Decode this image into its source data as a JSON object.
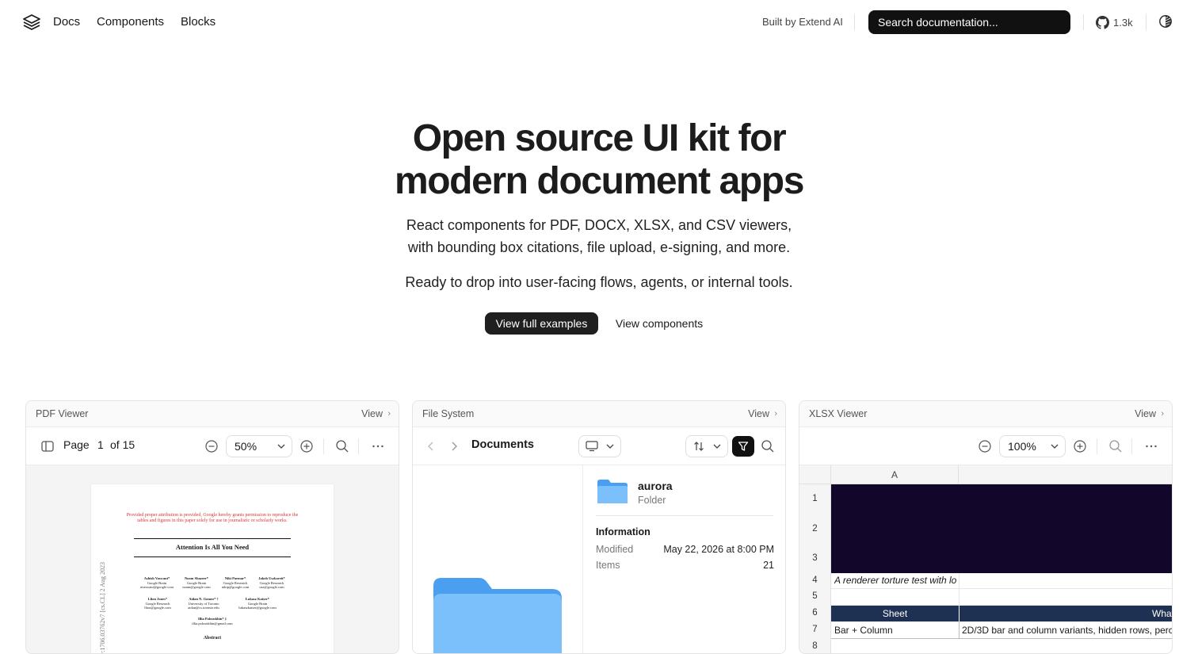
{
  "nav": {
    "links": [
      "Docs",
      "Components",
      "Blocks"
    ],
    "built_by": "Built by Extend AI",
    "search_placeholder": "Search documentation...",
    "github_stars": "1.3k"
  },
  "hero": {
    "title_line1": "Open source UI kit for",
    "title_line2": "modern document apps",
    "subtitle_line1": "React components for PDF, DOCX, XLSX, and CSV viewers,",
    "subtitle_line2": "with bounding box citations, file upload, e-signing, and more.",
    "subtitle_line3": "Ready to drop into user-facing flows, agents, or internal tools.",
    "primary_button": "View full examples",
    "secondary_button": "View components"
  },
  "cards": {
    "pdf": {
      "title": "PDF Viewer",
      "view": "View",
      "page_label": "Page",
      "page_current": "1",
      "page_total": "of 15",
      "zoom": "50%",
      "doc": {
        "notice": "Provided proper attribution is provided, Google hereby grants permission to reproduce the tables and figures in this paper solely for use in journalistic or scholarly works.",
        "title": "Attention Is All You Need",
        "authors": [
          {
            "name": "Ashish Vaswani*",
            "org": "Google Brain",
            "email": "avaswani@google.com"
          },
          {
            "name": "Noam Shazeer*",
            "org": "Google Brain",
            "email": "noam@google.com"
          },
          {
            "name": "Niki Parmar*",
            "org": "Google Research",
            "email": "nikip@google.com"
          },
          {
            "name": "Jakob Uszkoreit*",
            "org": "Google Research",
            "email": "usz@google.com"
          },
          {
            "name": "Llion Jones*",
            "org": "Google Research",
            "email": "llion@google.com"
          },
          {
            "name": "Aidan N. Gomez* †",
            "org": "University of Toronto",
            "email": "aidan@cs.toronto.edu"
          },
          {
            "name": "Łukasz Kaiser*",
            "org": "Google Brain",
            "email": "lukaszkaiser@google.com"
          },
          {
            "name": "Illia Polosukhin* ‡",
            "org": "",
            "email": "illia.polosukhin@gmail.com"
          }
        ],
        "abstract": "Abstract",
        "side_text": "arXiv:1706.03762v7  [cs.CL]  2 Aug 2023"
      }
    },
    "fs": {
      "title": "File System",
      "view": "View",
      "location": "Documents",
      "item_name": "aurora",
      "item_kind": "Folder",
      "info_heading": "Information",
      "modified_label": "Modified",
      "modified_value": "May 22, 2026 at 8:00 PM",
      "items_label": "Items",
      "items_value": "21"
    },
    "xlsx": {
      "title": "XLSX Viewer",
      "view": "View",
      "zoom": "100%",
      "col_a": "A",
      "rows": [
        "1",
        "2",
        "3",
        "4",
        "5",
        "6",
        "7",
        "8"
      ],
      "row4_text": "A renderer torture test with lo",
      "header_sheet": "Sheet",
      "header_what": "What",
      "row7_a": "Bar + Column",
      "row7_b": "2D/3D bar and column variants, hidden rows, perc"
    }
  },
  "colors": {
    "search_bg": "#111111",
    "primary_button_bg": "#1f1f1f",
    "xlsx_banner": "#12062a",
    "xlsx_header": "#1f3152",
    "folder_blue": "#4a9ff0"
  }
}
